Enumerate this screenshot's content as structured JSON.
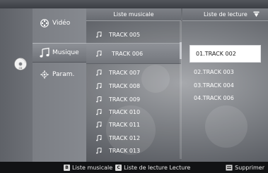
{
  "menu": {
    "items": [
      {
        "label": "Vidéo",
        "icon": "video-reel-icon",
        "active": false
      },
      {
        "label": "Musique",
        "icon": "music-note-icon",
        "active": true
      },
      {
        "label": "Param.",
        "icon": "settings-gear-icon",
        "active": false
      }
    ]
  },
  "disc": {
    "label": "CD",
    "icon": "cd-disc-icon"
  },
  "music_list": {
    "header": "Liste musicale",
    "tracks": [
      "TRACK 005",
      "TRACK 006",
      "TRACK 007",
      "TRACK 008",
      "TRACK 009",
      "TRACK 010",
      "TRACK 011",
      "TRACK 012",
      "TRACK 013"
    ],
    "focused_index": 1
  },
  "playlist": {
    "header": "Liste de lecture",
    "items": [
      "01.TRACK 002",
      "02.TRACK 003",
      "03.TRACK 004",
      "04.TRACK 006"
    ],
    "focused_index": 0
  },
  "footer": {
    "key_b": "B",
    "b_text": "Liste musicale",
    "key_c": "C",
    "c_text": "Liste de lecture Lecture",
    "delete_text": "Supprimer"
  },
  "colors": {
    "accent": "#ffffff",
    "background": "#7d8085",
    "bottombar": "#111214"
  }
}
